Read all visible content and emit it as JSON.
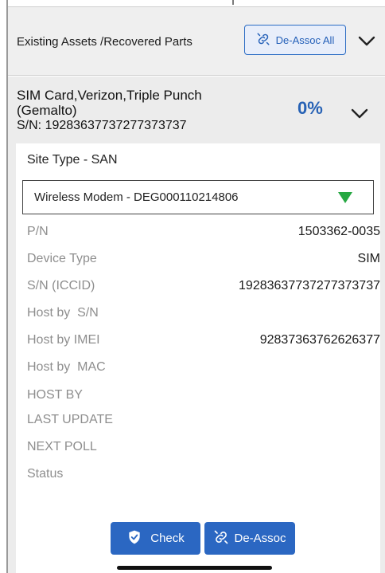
{
  "header": {
    "title": "Existing Assets /Recovered Parts",
    "deassoc_all_label": "De-Assoc All",
    "icons": {
      "deassoc": "unlink-icon",
      "expand": "chevron-down-icon"
    }
  },
  "item": {
    "title": "SIM Card,Verizon,Triple Punch (Gemalto)",
    "serial_line": "S/N: 19283637737277373737",
    "progress_percent": "0%",
    "accent_color": "#2762b5"
  },
  "detail": {
    "site_type": "Site Type - SAN",
    "device_select": {
      "value": "Wireless Modem - DEG000110214806",
      "indicator_color": "#26a842"
    },
    "fields": [
      {
        "label": "P/N",
        "value": "1503362-0035"
      },
      {
        "label": "Device Type",
        "value": "SIM"
      },
      {
        "label": "S/N (ICCID)",
        "value": "19283637737277373737"
      },
      {
        "label": "Host by  S/N",
        "value": ""
      },
      {
        "label": "Host by IMEI",
        "value": "92837363762626377"
      },
      {
        "label": "Host by  MAC",
        "value": ""
      },
      {
        "label": "HOST BY",
        "value": ""
      },
      {
        "label": "LAST UPDATE",
        "value": ""
      },
      {
        "label": "NEXT POLL",
        "value": ""
      },
      {
        "label": "Status",
        "value": ""
      }
    ]
  },
  "actions": {
    "check_label": "Check",
    "deassoc_label": "De-Assoc",
    "check_icon": "shield-check-icon",
    "deassoc_icon": "unlink-icon",
    "button_color": "#2b67c2"
  }
}
